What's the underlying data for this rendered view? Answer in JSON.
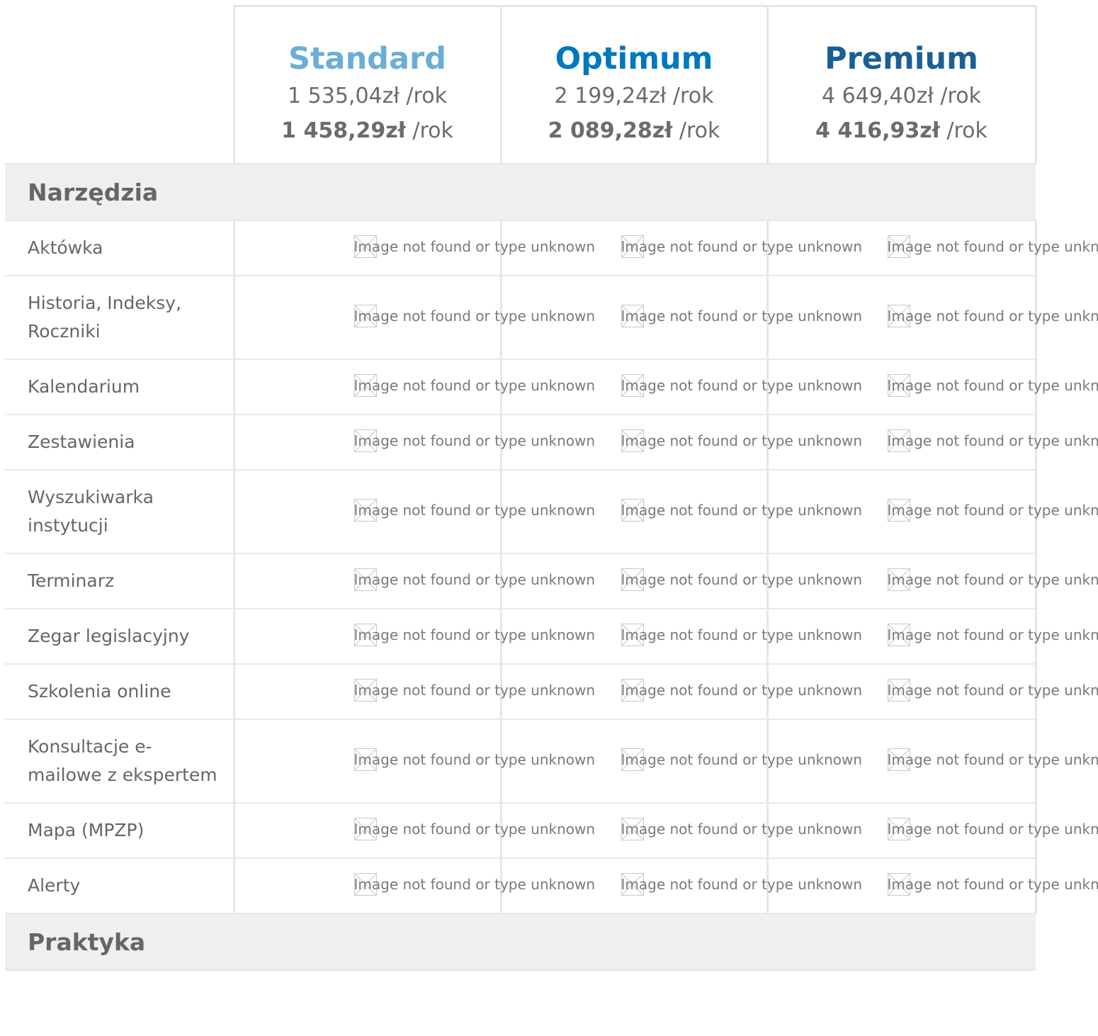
{
  "plans": [
    {
      "name": "Standard",
      "price": "1 535,04zł /rok",
      "promo_price": "1 458,29zł",
      "promo_suffix": " /rok",
      "color": "#6aaed6"
    },
    {
      "name": "Optimum",
      "price": "2 199,24zł /rok",
      "promo_price": "2 089,28zł",
      "promo_suffix": " /rok",
      "color": "#0078bf"
    },
    {
      "name": "Premium",
      "price": "4 649,40zł /rok",
      "promo_price": "4 416,93zł",
      "promo_suffix": " /rok",
      "color": "#1a5f96"
    }
  ],
  "missing_image_text": "Image not found or type unknown",
  "sections": [
    {
      "title": "Narzędzia",
      "features": [
        "Aktówka",
        "Historia, Indeksy, Roczniki",
        "Kalendarium",
        "Zestawienia",
        "Wyszukiwarka instytucji",
        "Terminarz",
        "Zegar legislacyjny",
        "Szkolenia online",
        "Konsultacje e-mailowe z ekspertem",
        "Mapa (MPZP)",
        "Alerty"
      ]
    },
    {
      "title": "Praktyka",
      "features": []
    }
  ]
}
